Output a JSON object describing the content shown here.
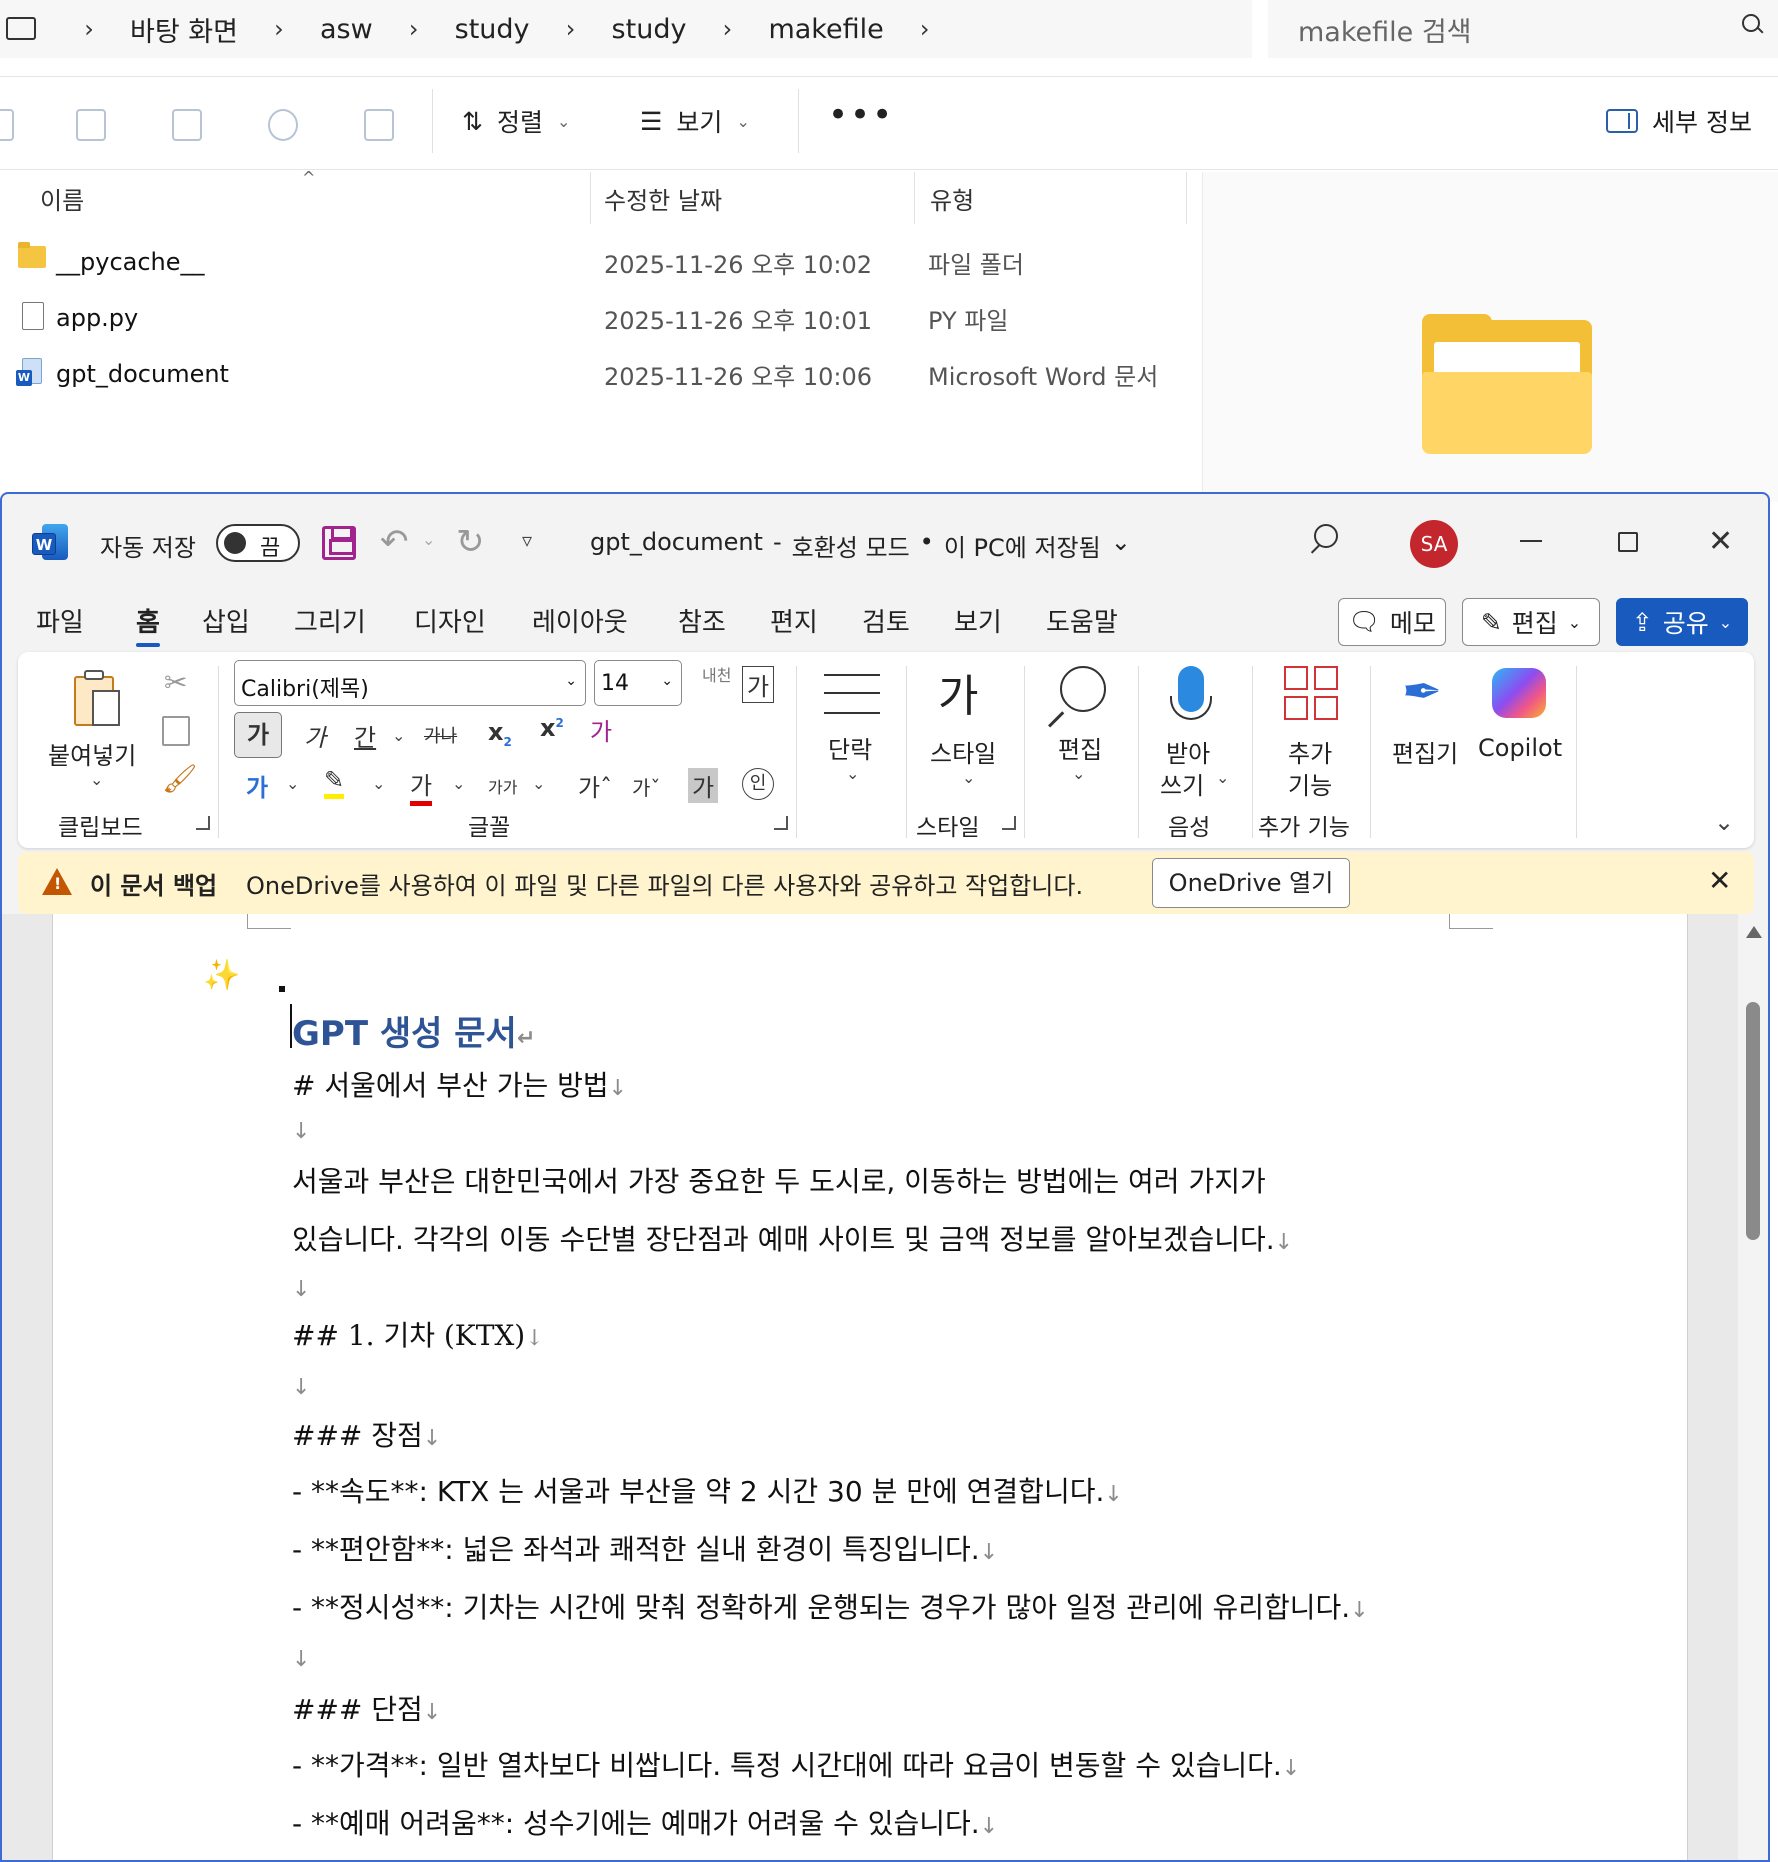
{
  "explorer": {
    "breadcrumb": [
      "바탕 화면",
      "asw",
      "study",
      "study",
      "makefile"
    ],
    "search_placeholder": "makefile 검색",
    "toolbar": {
      "sort": "정렬",
      "view": "보기",
      "more": "•••",
      "details": "세부 정보"
    },
    "columns": {
      "name": "이름",
      "date": "수정한 날짜",
      "type": "유형"
    },
    "files": [
      {
        "name": "__pycache__",
        "date": "2025-11-26 오후 10:02",
        "type": "파일 폴더",
        "icon": "folder-icon"
      },
      {
        "name": "app.py",
        "date": "2025-11-26 오후 10:01",
        "type": "PY 파일",
        "icon": "file-icon"
      },
      {
        "name": "gpt_document",
        "date": "2025-11-26 오후 10:06",
        "type": "Microsoft Word 문서",
        "icon": "word-doc-icon"
      }
    ]
  },
  "word": {
    "autosave_label": "자동 저장",
    "autosave_state": "끔",
    "doc_name": "gpt_document",
    "doc_mode": "호환성 모드",
    "save_status": "이 PC에 저장됨",
    "user_initials": "SA",
    "menu": [
      "파일",
      "홈",
      "삽입",
      "그리기",
      "디자인",
      "레이아웃",
      "참조",
      "편지",
      "검토",
      "보기",
      "도움말"
    ],
    "menu_buttons": {
      "comment": "메모",
      "editing": "편집",
      "share": "공유"
    },
    "ribbon": {
      "paste": "붙여넣기",
      "clipboard": "클립보드",
      "font_name": "Calibri(제목)",
      "font_size": "14",
      "font_group": "글꼴",
      "paragraph": "단락",
      "styles": "스타일",
      "styles_group": "스타일",
      "edit": "편집",
      "dictate_1": "받아",
      "dictate_2": "쓰기",
      "voice_group": "음성",
      "addins_1": "추가",
      "addins_2": "기능",
      "addins_group": "추가 기능",
      "editor": "편집기",
      "copilot": "Copilot"
    },
    "message_bar": {
      "title": "이 문서 백업",
      "text": "OneDrive를 사용하여 이 파일 및 다른 파일의 다른 사용자와 공유하고 작업합니다.",
      "button": "OneDrive 열기"
    },
    "document": {
      "heading": "GPT 생성 문서",
      "lines": [
        "# 서울에서 부산 가는 방법",
        "",
        "서울과 부산은 대한민국에서 가장 중요한 두 도시로, 이동하는 방법에는 여러 가지가",
        "있습니다. 각각의 이동 수단별 장단점과 예매 사이트 및 금액 정보를 알아보겠습니다.",
        "",
        "## 1. 기차 (KTX)",
        "",
        "### 장점",
        "- **속도**: KTX 는 서울과 부산을 약 2 시간 30 분 만에 연결합니다.",
        "- **편안함**: 넓은 좌석과 쾌적한 실내 환경이 특징입니다.",
        "- **정시성**: 기차는 시간에 맞춰 정확하게 운행되는 경우가 많아 일정 관리에 유리합니다.",
        "",
        "### 단점",
        "- **가격**: 일반 열차보다 비쌉니다. 특정 시간대에 따라 요금이 변동할 수 있습니다.",
        "- **예매 어려움**: 성수기에는 예매가 어려울 수 있습니다."
      ]
    }
  }
}
